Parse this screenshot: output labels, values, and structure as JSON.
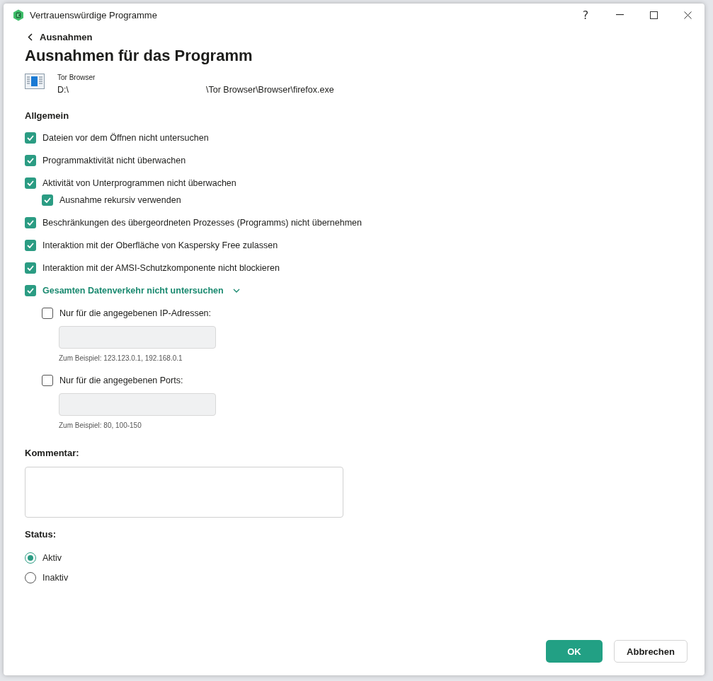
{
  "window": {
    "title": "Vertrauenswürdige Programme",
    "help": "?"
  },
  "back_link": "Ausnahmen",
  "heading": "Ausnahmen für das Programm",
  "program": {
    "name": "Tor Browser",
    "path_start": "D:\\",
    "path_end": "\\Tor Browser\\Browser\\firefox.exe"
  },
  "section": "Allgemein",
  "options": [
    {
      "kind": "checkbox",
      "label": "Dateien vor dem Öffnen nicht untersuchen",
      "checked": true
    },
    {
      "kind": "checkbox",
      "label": "Programmaktivität nicht überwachen",
      "checked": true
    },
    {
      "kind": "checkbox",
      "label": "Aktivität von Unterprogrammen nicht überwachen",
      "checked": true,
      "children": [
        {
          "kind": "checkbox",
          "label": "Ausnahme rekursiv verwenden",
          "checked": true
        }
      ]
    },
    {
      "kind": "checkbox",
      "label": "Beschränkungen des übergeordneten Prozesses (Programms) nicht übernehmen",
      "checked": true
    },
    {
      "kind": "checkbox",
      "label": "Interaktion mit der Oberfläche von Kaspersky Free zulassen",
      "checked": true
    },
    {
      "kind": "checkbox",
      "label": "Interaktion mit der AMSI-Schutzkomponente nicht blockieren",
      "checked": true
    },
    {
      "kind": "expander",
      "label": "Gesamten Datenverkehr nicht untersuchen",
      "checked": true,
      "expanded": true,
      "children": [
        {
          "kind": "filter",
          "label": "Nur für die angegebenen IP-Adressen:",
          "checked": false,
          "hint": "Zum Beispiel: 123.123.0.1, 192.168.0.1"
        },
        {
          "kind": "filter",
          "label": "Nur für die angegebenen Ports:",
          "checked": false,
          "hint": "Zum Beispiel: 80, 100-150"
        }
      ]
    }
  ],
  "comment": {
    "label": "Kommentar:"
  },
  "status": {
    "label": "Status:",
    "options": [
      {
        "label": "Aktiv",
        "selected": true
      },
      {
        "label": "Inaktiv",
        "selected": false
      }
    ]
  },
  "buttons": [
    {
      "kind": "primary",
      "label": "OK"
    },
    {
      "kind": "secondary",
      "label": "Abbrechen"
    }
  ]
}
